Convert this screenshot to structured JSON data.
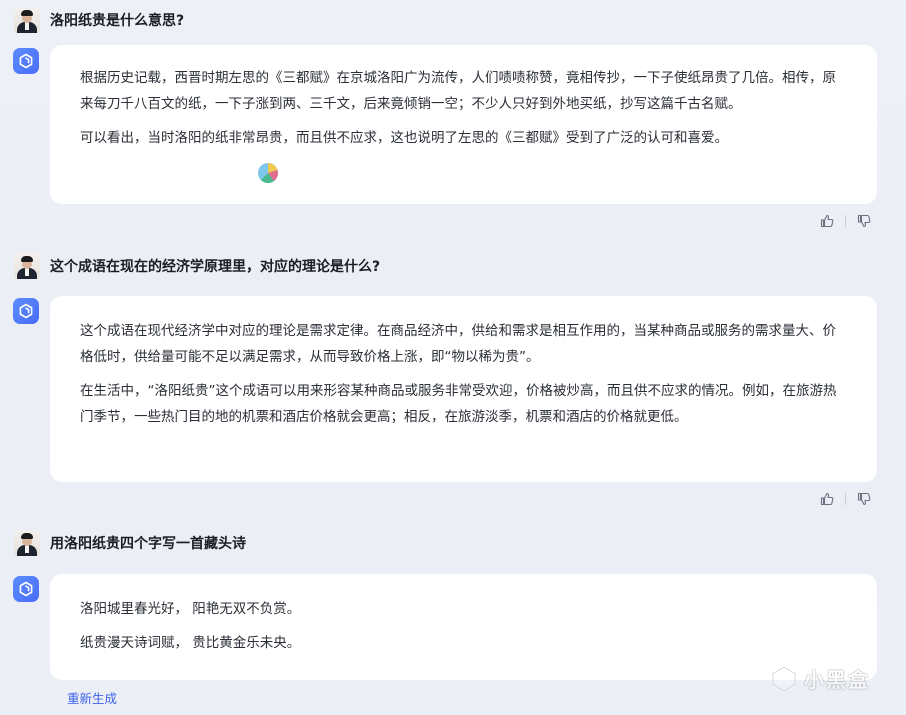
{
  "conversation": [
    {
      "question": "洛阳纸贵是什么意思?",
      "answer": [
        "根据历史记载，西晋时期左思的《三都赋》在京城洛阳广为流传，人们啧啧称赞，竟相传抄，一下子使纸昂贵了几倍。相传，原来每刀千八百文的纸，一下子涨到两、三千文，后来竟倾销一空；不少人只好到外地买纸，抄写这篇千古名赋。",
        "可以看出，当时洛阳的纸非常昂贵，而且供不应求，这也说明了左思的《三都赋》受到了广泛的认可和喜爱。"
      ]
    },
    {
      "question": "这个成语在现在的经济学原理里，对应的理论是什么?",
      "answer": [
        "这个成语在现代经济学中对应的理论是需求定律。在商品经济中，供给和需求是相互作用的，当某种商品或服务的需求量大、价格低时，供给量可能不足以满足需求，从而导致价格上涨，即“物以稀为贵”。",
        "在生活中，“洛阳纸贵”这个成语可以用来形容某种商品或服务非常受欢迎，价格被炒高，而且供不应求的情况。例如，在旅游热门季节，一些热门目的地的机票和酒店价格就会更高；相反，在旅游淡季，机票和酒店的价格就更低。"
      ]
    },
    {
      "question": "用洛阳纸贵四个字写一首藏头诗",
      "answer": [
        "洛阳城里春光好， 阳艳无双不负赏。",
        "纸贵漫天诗词赋， 贵比黄金乐未央。"
      ]
    }
  ],
  "actions": {
    "regenerate_label": "重新生成"
  },
  "icons": {
    "bot": "bot-logo-icon",
    "like": "thumbs-up-icon",
    "dislike": "thumbs-down-icon"
  },
  "watermark": {
    "text": "小黑盒"
  },
  "colors": {
    "accent": "#4a6cf7",
    "link": "#3d63ea",
    "background": "#eef0f7",
    "bubble": "#ffffff"
  }
}
